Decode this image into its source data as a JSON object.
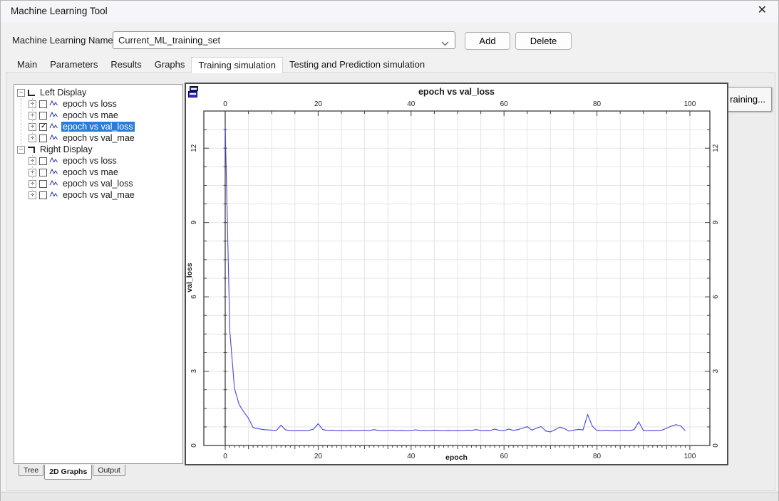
{
  "window": {
    "title": "Machine Learning Tool",
    "close_glyph": "✕"
  },
  "name_row": {
    "label": "Machine Learning Name:",
    "value": "Current_ML_training_set",
    "add": "Add",
    "delete": "Delete"
  },
  "tabs": {
    "items": [
      "Main",
      "Parameters",
      "Results",
      "Graphs",
      "Training simulation",
      "Testing and Prediction simulation"
    ],
    "active_index": 4
  },
  "tree": {
    "groups": [
      {
        "label": "Left Display",
        "icon": "left-corner",
        "items": [
          {
            "label": "epoch vs loss",
            "checked": false,
            "selected": false
          },
          {
            "label": "epoch vs mae",
            "checked": false,
            "selected": false
          },
          {
            "label": "epoch vs val_loss",
            "checked": true,
            "selected": true
          },
          {
            "label": "epoch vs val_mae",
            "checked": false,
            "selected": false
          }
        ]
      },
      {
        "label": "Right Display",
        "icon": "right-corner",
        "items": [
          {
            "label": "epoch vs loss",
            "checked": false,
            "selected": false
          },
          {
            "label": "epoch vs mae",
            "checked": false,
            "selected": false
          },
          {
            "label": "epoch vs val_loss",
            "checked": false,
            "selected": false
          },
          {
            "label": "epoch vs val_mae",
            "checked": false,
            "selected": false
          }
        ]
      }
    ]
  },
  "side_button": {
    "visible_label": "raining..."
  },
  "bottom_tabs": {
    "items": [
      "Tree",
      "2D Graphs",
      "Output"
    ],
    "active_index": 1
  },
  "colors": {
    "selection": "#2a7cd8",
    "axis": "#3c3c3c",
    "grid": "#e4e4e4"
  },
  "chart_data": {
    "type": "line",
    "title": "epoch vs val_loss",
    "xlabel": "epoch",
    "ylabel": "val_loss",
    "xlim": [
      -4.6,
      104.3
    ],
    "ylim": [
      0,
      13.5
    ],
    "x_ticks": [
      0,
      20,
      40,
      60,
      80,
      100
    ],
    "y_ticks": [
      0,
      3,
      6,
      9,
      12
    ],
    "x_minor_step": 5,
    "x_fine_step": 1,
    "y_minor_step": 0.75,
    "grid": true,
    "legend": "none",
    "line_color": "#4646d6",
    "series": [
      {
        "name": "val_loss",
        "x_start": 0,
        "x_step": 1,
        "y": [
          12.9,
          4.6,
          2.3,
          1.65,
          1.35,
          1.1,
          0.72,
          0.68,
          0.65,
          0.63,
          0.62,
          0.6,
          0.82,
          0.63,
          0.6,
          0.6,
          0.61,
          0.6,
          0.61,
          0.66,
          0.88,
          0.64,
          0.61,
          0.62,
          0.6,
          0.61,
          0.6,
          0.61,
          0.6,
          0.61,
          0.62,
          0.6,
          0.64,
          0.61,
          0.6,
          0.61,
          0.62,
          0.6,
          0.61,
          0.6,
          0.61,
          0.63,
          0.6,
          0.61,
          0.6,
          0.62,
          0.61,
          0.6,
          0.61,
          0.6,
          0.61,
          0.6,
          0.62,
          0.61,
          0.64,
          0.6,
          0.61,
          0.6,
          0.66,
          0.61,
          0.6,
          0.66,
          0.61,
          0.64,
          0.7,
          0.76,
          0.62,
          0.7,
          0.76,
          0.58,
          0.55,
          0.64,
          0.74,
          0.68,
          0.58,
          0.62,
          0.65,
          0.63,
          1.25,
          0.78,
          0.6,
          0.6,
          0.62,
          0.6,
          0.61,
          0.6,
          0.62,
          0.6,
          0.64,
          0.95,
          0.6,
          0.6,
          0.61,
          0.6,
          0.62,
          0.7,
          0.78,
          0.84,
          0.8,
          0.6
        ]
      }
    ]
  }
}
